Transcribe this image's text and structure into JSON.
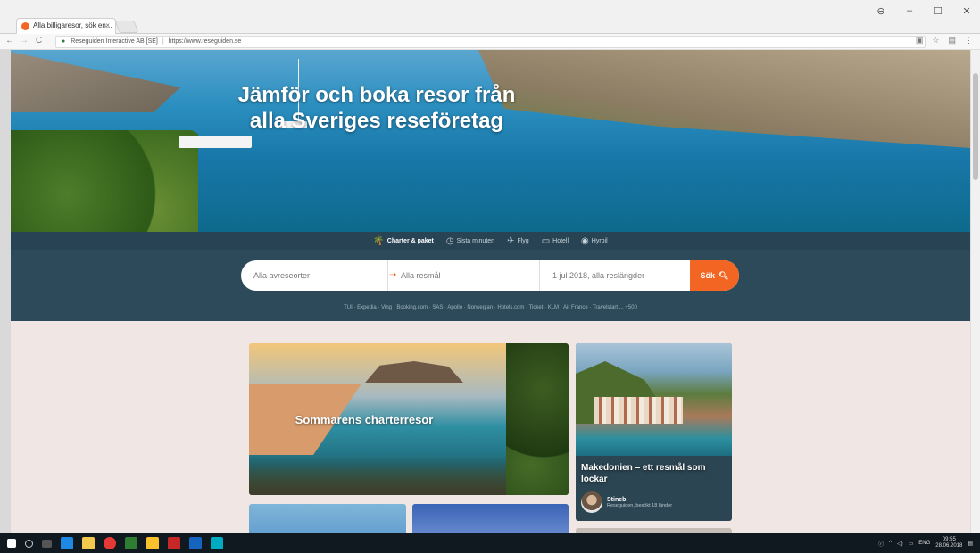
{
  "browser": {
    "tab_title": "Alla billigaresor, sök en...",
    "tab_close": "×",
    "window_buttons": [
      "⊖",
      "–",
      "☐",
      "✕"
    ],
    "back": "←",
    "forward": "→",
    "reload": "C",
    "site_identity": "Reseguiden Interactive AB [SE]",
    "url": "https://www.reseguiden.se",
    "toolbar_icons": [
      "translate-icon",
      "star-icon",
      "extensions-icon",
      "menu-icon"
    ]
  },
  "hero": {
    "title_line1": "Jämför och boka resor från",
    "title_line2": "alla Sveriges reseföretag"
  },
  "search": {
    "tabs": [
      {
        "label": "Charter & paket",
        "icon": "🌴",
        "active": true
      },
      {
        "label": "Sista minuten",
        "icon": "◷",
        "active": false
      },
      {
        "label": "Flyg",
        "icon": "✈",
        "active": false
      },
      {
        "label": "Hotell",
        "icon": "▭",
        "active": false
      },
      {
        "label": "Hyrbil",
        "icon": "◉",
        "active": false
      }
    ],
    "departure_placeholder": "Alla avreseorter",
    "destination_placeholder": "Alla resmål",
    "date_placeholder": "1 jul 2018, alla reslängder",
    "button_label": "Sök",
    "partners": "TUI · Expedia · Ving · Booking.com · SAS · Apollo · Norwegian · Hotels.com · Ticket · KLM · Air France · Travelstart ... +500"
  },
  "cards": {
    "featured_title": "Sommarens charterresor",
    "article_title": "Makedonien – ett resmål som lockar",
    "author_name": "Stineb",
    "author_sub": "Reseguiden, besökt 18 länder"
  },
  "taskbar": {
    "language": "ENG",
    "time": "09:55",
    "date": "28.06.2018"
  }
}
